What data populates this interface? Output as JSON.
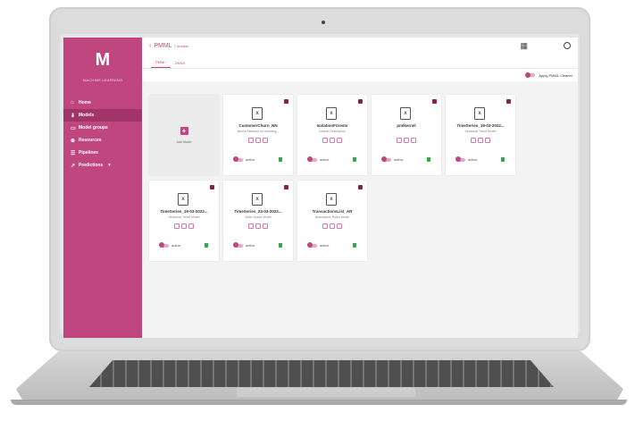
{
  "app": {
    "logo_mark": "M",
    "logo_text": "MACHINE LEARNING"
  },
  "sidebar": {
    "items": [
      {
        "label": "Home",
        "icon": "home-icon",
        "glyph": "⌂"
      },
      {
        "label": "Models",
        "icon": "models-icon",
        "glyph": "⬇"
      },
      {
        "label": "Model groups",
        "icon": "model-groups-icon",
        "glyph": "▭"
      },
      {
        "label": "Resources",
        "icon": "resources-icon",
        "glyph": "⊛"
      },
      {
        "label": "Pipelines",
        "icon": "pipelines-icon",
        "glyph": "☰"
      },
      {
        "label": "Predictions",
        "icon": "predictions-icon",
        "glyph": "↗"
      }
    ],
    "active_index": 1
  },
  "header": {
    "title": "PMML",
    "subtitle": "7 models"
  },
  "tabs": [
    {
      "label": "PMML",
      "active": true
    },
    {
      "label": "ONNX",
      "active": false
    }
  ],
  "toolbar": {
    "toggle_label": "Apply PMML Cleaner"
  },
  "add_card": {
    "label": "Add Model"
  },
  "models": [
    {
      "name": "CustomerChurn_NN",
      "description": "Neural Network for reducing...",
      "status": "active"
    },
    {
      "name": "IsolationForests",
      "description": "Default Description",
      "status": "active"
    },
    {
      "name": "pmlkernel",
      "description": "",
      "status": "active"
    },
    {
      "name": "TimeSeries_19-03-2022...",
      "description": "Seasonal Trend Model",
      "status": "active"
    },
    {
      "name": "TimeSeries_19-03-2022...",
      "description": "Seasonal Trend Model",
      "status": "active"
    },
    {
      "name": "TimeSeries_23-03-2022...",
      "description": "State Space Model",
      "status": "active"
    },
    {
      "name": "TransactionsList_AR",
      "description": "Association Rules Model",
      "status": "active"
    }
  ],
  "colors": {
    "brand": "#c0467f",
    "brand_dark": "#a1356a",
    "success": "#2fa84f"
  }
}
